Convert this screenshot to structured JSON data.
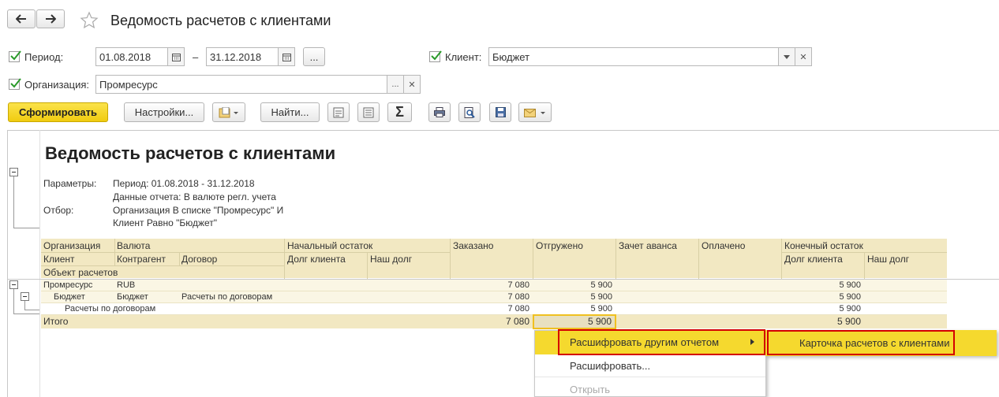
{
  "window": {
    "title": "Ведомость расчетов с клиентами"
  },
  "filters": {
    "period_label": "Период:",
    "date_from": "01.08.2018",
    "date_sep": "–",
    "date_to": "31.12.2018",
    "ellipsis": "...",
    "client_label": "Клиент:",
    "client_value": "Бюджет",
    "org_label": "Организация:",
    "org_value": "Промресурс"
  },
  "toolbar": {
    "generate": "Сформировать",
    "settings": "Настройки...",
    "find": "Найти...",
    "sum": "Σ"
  },
  "report": {
    "title": "Ведомость расчетов с клиентами",
    "params_label": "Параметры:",
    "params_line1": "Период: 01.08.2018 - 31.12.2018",
    "params_line2": "Данные отчета: В валюте регл. учета",
    "filter_label": "Отбор:",
    "filter_line1": "Организация В списке \"Промресурс\" И",
    "filter_line2": "Клиент Равно \"Бюджет\""
  },
  "table": {
    "headers": {
      "org": "Организация",
      "currency": "Валюта",
      "client": "Клиент",
      "counterparty": "Контрагент",
      "contract": "Договор",
      "object": "Объект расчетов",
      "opening": "Начальный остаток",
      "client_debt": "Долг клиента",
      "our_debt": "Наш долг",
      "ordered": "Заказано",
      "shipped": "Отгружено",
      "advance": "Зачет аванса",
      "paid": "Оплачено",
      "closing": "Конечный остаток",
      "client_debt2": "Долг клиента",
      "our_debt2": "Наш долг"
    },
    "rows": [
      {
        "c1": "Промресурс",
        "c2": "RUB",
        "c3": "",
        "ordered": "7 080",
        "shipped": "5 900",
        "closing": "5 900"
      },
      {
        "c1": "Бюджет",
        "c2": "Бюджет",
        "c3": "Расчеты по договорам",
        "ordered": "7 080",
        "shipped": "5 900",
        "closing": "5 900"
      },
      {
        "c1": "Расчеты по договорам",
        "c2": "",
        "c3": "",
        "ordered": "7 080",
        "shipped": "5 900",
        "closing": "5 900"
      }
    ],
    "total": {
      "label": "Итого",
      "ordered": "7 080",
      "shipped": "5 900",
      "closing": "5 900"
    }
  },
  "context_menu": {
    "item1": "Расшифровать другим отчетом",
    "item2": "Расшифровать...",
    "item3": "Открыть",
    "submenu_item": "Карточка расчетов с клиентами"
  },
  "colors": {
    "accent": "#f5d92e",
    "highlight_border": "#d40000",
    "header_bg": "#f2e8c2"
  }
}
